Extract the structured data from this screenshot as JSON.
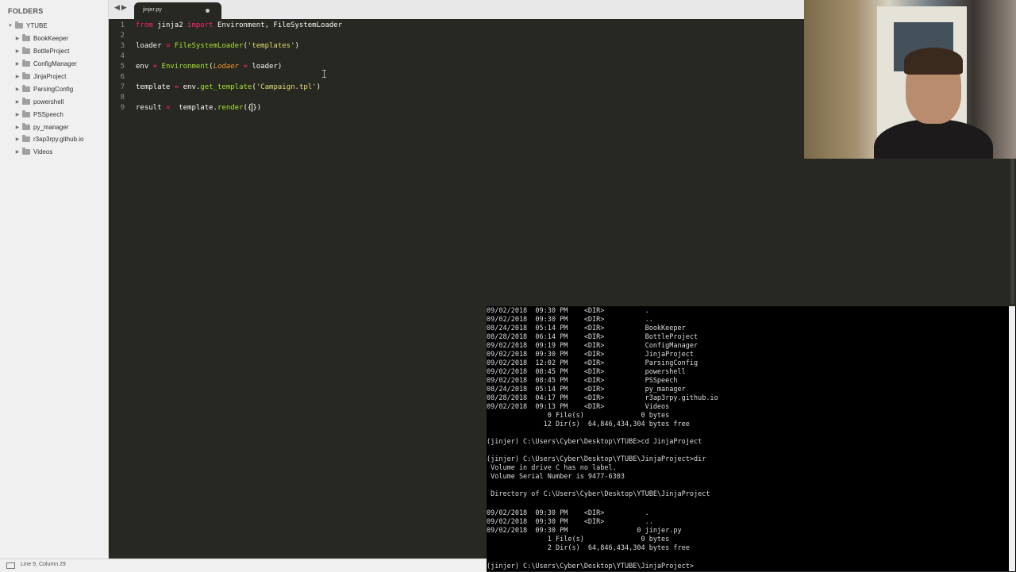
{
  "sidebar": {
    "header": "FOLDERS",
    "root": "YTUBE",
    "folders": [
      "BookKeeper",
      "BottleProject",
      "ConfigManager",
      "JinjaProject",
      "ParsingConfig",
      "powershell",
      "PSSpeech",
      "py_manager",
      "r3ap3rpy.github.io",
      "Videos"
    ]
  },
  "statusbar": {
    "text": "Line 9, Column 29"
  },
  "tab": {
    "label": "jinjer.py"
  },
  "editor": {
    "line_numbers": [
      "1",
      "2",
      "3",
      "4",
      "5",
      "6",
      "7",
      "8",
      "9"
    ],
    "line1": {
      "kw1": "from",
      "mod": " jinja2 ",
      "kw2": "import",
      "rest": " Environment, FileSystemLoader"
    },
    "line3": {
      "var": "loader ",
      "op": "=",
      "sp": " ",
      "fn": "FileSystemLoader",
      "p1": "(",
      "str": "'templates'",
      "p2": ")"
    },
    "line5": {
      "var": "env ",
      "op": "=",
      "sp": " ",
      "fn": "Environment",
      "p1": "(",
      "par": "Lodaer",
      "sp2": " ",
      "op2": "=",
      "rest": " loader)"
    },
    "line7": {
      "var": "template ",
      "op": "=",
      "sp": " ",
      "obj": "env.",
      "fn": "get_template",
      "p1": "(",
      "str": "'Campaign.tpl'",
      "p2": ")"
    },
    "line9": {
      "var": "result ",
      "op": "=",
      "sp": "  ",
      "obj": "template.",
      "fn": "render",
      "p1": "({",
      "p2": "})"
    }
  },
  "terminal": {
    "lines": [
      "09/02/2018  09:30 PM    <DIR>          .",
      "09/02/2018  09:30 PM    <DIR>          ..",
      "08/24/2018  05:14 PM    <DIR>          BookKeeper",
      "08/28/2018  06:14 PM    <DIR>          BottleProject",
      "09/02/2018  09:19 PM    <DIR>          ConfigManager",
      "09/02/2018  09:30 PM    <DIR>          JinjaProject",
      "09/02/2018  12:02 PM    <DIR>          ParsingConfig",
      "09/02/2018  08:45 PM    <DIR>          powershell",
      "09/02/2018  08:45 PM    <DIR>          PSSpeech",
      "08/24/2018  05:14 PM    <DIR>          py_manager",
      "08/28/2018  04:17 PM    <DIR>          r3ap3rpy.github.io",
      "09/02/2018  09:13 PM    <DIR>          Videos",
      "               0 File(s)              0 bytes",
      "              12 Dir(s)  64,846,434,304 bytes free",
      "",
      "(jinjer) C:\\Users\\Cyber\\Desktop\\YTUBE>cd JinjaProject",
      "",
      "(jinjer) C:\\Users\\Cyber\\Desktop\\YTUBE\\JinjaProject>dir",
      " Volume in drive C has no label.",
      " Volume Serial Number is 9477-6303",
      "",
      " Directory of C:\\Users\\Cyber\\Desktop\\YTUBE\\JinjaProject",
      "",
      "09/02/2018  09:30 PM    <DIR>          .",
      "09/02/2018  09:30 PM    <DIR>          ..",
      "09/02/2018  09:30 PM                 0 jinjer.py",
      "               1 File(s)              0 bytes",
      "               2 Dir(s)  64,846,434,304 bytes free",
      "",
      "(jinjer) C:\\Users\\Cyber\\Desktop\\YTUBE\\JinjaProject>"
    ]
  }
}
